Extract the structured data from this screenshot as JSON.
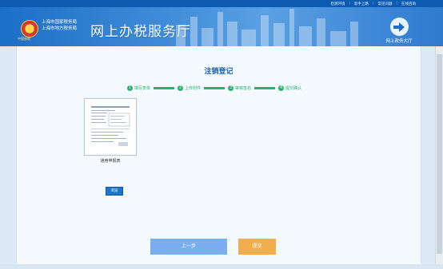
{
  "toplinks": [
    "检测环境",
    "新手上路",
    "常见问题",
    "在线咨询"
  ],
  "header": {
    "emblem_text": "中国税收",
    "bureau_line1": "上海市国家税务局",
    "bureau_line2": "上海市地方税务局",
    "hall_title": "网上办税服务厅",
    "gov_label": "网上政务大厅"
  },
  "page": {
    "title": "注销登记",
    "steps": [
      {
        "num": "1",
        "label": "填写表单"
      },
      {
        "num": "2",
        "label": "上传附件"
      },
      {
        "num": "3",
        "label": "审核签名"
      },
      {
        "num": "4",
        "label": "提交确认"
      }
    ],
    "attachment_name": "通用申报表",
    "browse_label": "浏览",
    "prev_label": "上一步",
    "submit_label": "提交"
  },
  "colors": {
    "top_bar": "#0c5bb0",
    "step_green": "#27b36b",
    "prev_button": "#79aef0",
    "submit_button": "#f2ad4c"
  }
}
